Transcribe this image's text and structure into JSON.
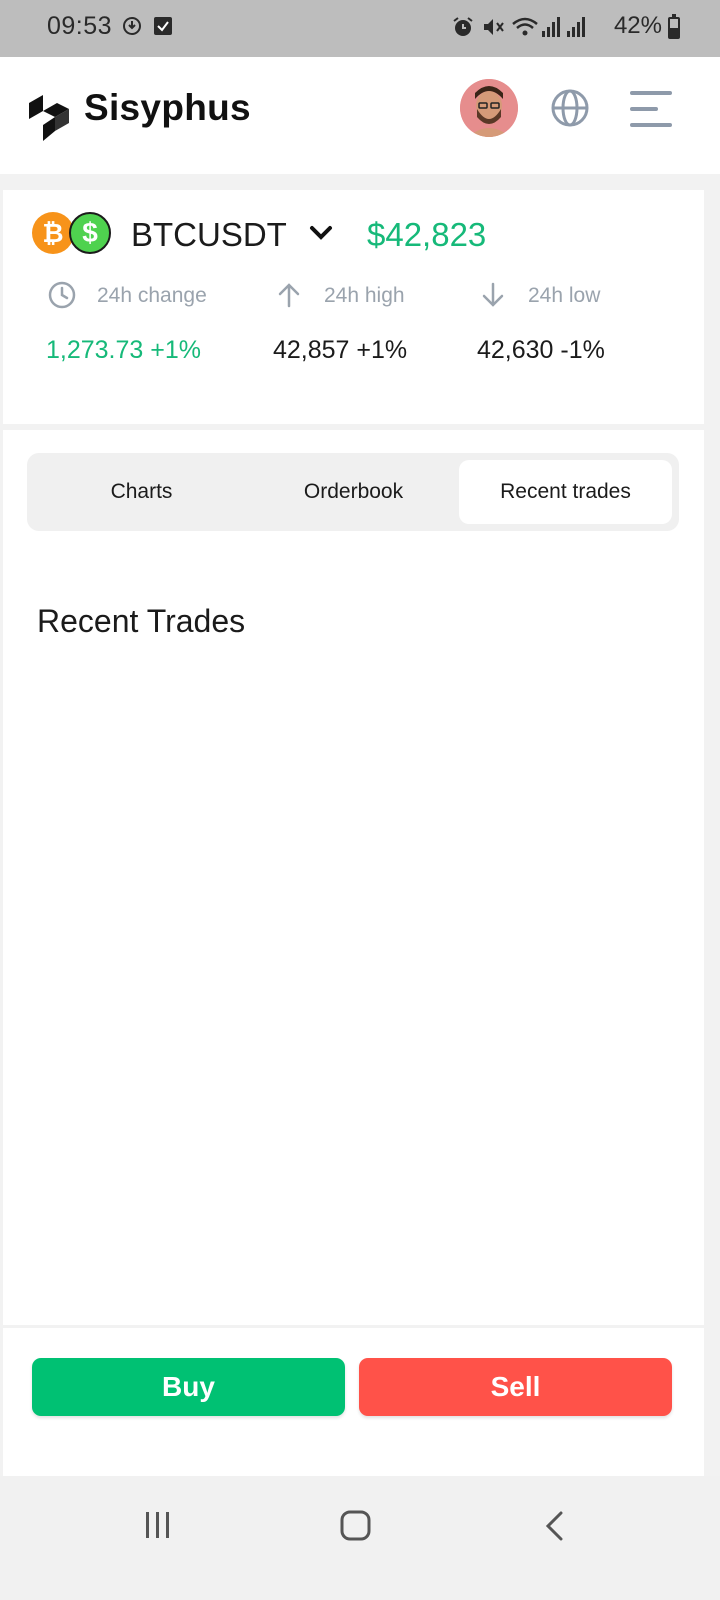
{
  "status_bar": {
    "time": "09:53",
    "battery": "42%"
  },
  "header": {
    "brand": "Sisyphus"
  },
  "ticker": {
    "pair": "BTCUSDT",
    "price": "$42,823",
    "base_coin_symbol": "₿",
    "quote_coin_symbol": "$",
    "stats": [
      {
        "label": "24h change",
        "value": "1,273.73 +1%"
      },
      {
        "label": "24h high",
        "value": "42,857 +1%"
      },
      {
        "label": "24h low",
        "value": "42,630 -1%"
      }
    ]
  },
  "tabs": [
    "Charts",
    "Orderbook",
    "Recent trades"
  ],
  "active_tab": "Recent trades",
  "section": {
    "title": "Recent Trades"
  },
  "actions": {
    "buy": "Buy",
    "sell": "Sell"
  },
  "colors": {
    "green": "#16b979",
    "buy": "#00c173",
    "sell": "#ff5249"
  },
  "icons": [
    "clock-icon",
    "arrow-up-icon",
    "arrow-down-icon",
    "globe-icon",
    "menu-icon",
    "chevron-down-icon"
  ]
}
